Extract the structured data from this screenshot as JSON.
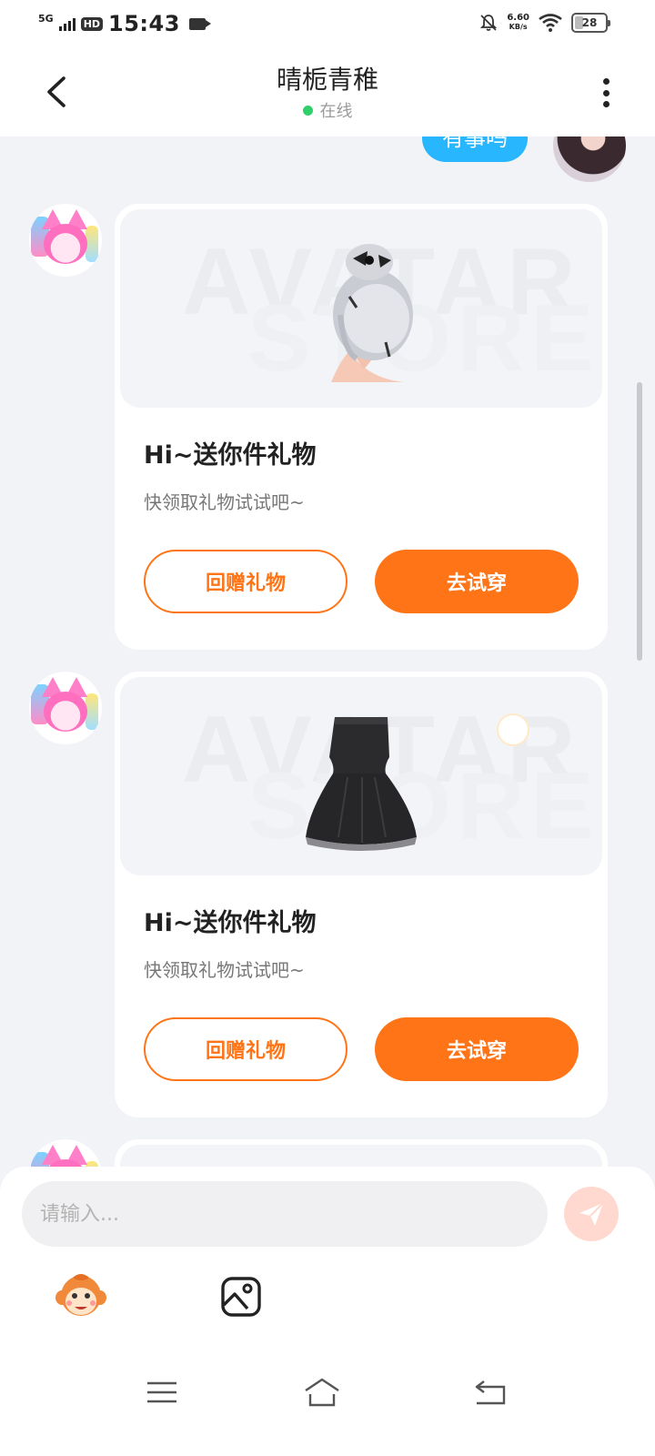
{
  "status_bar": {
    "network": "5G",
    "hd": "HD",
    "time": "15:43",
    "speed_value": "6.60",
    "speed_unit": "KB/s",
    "battery": "28"
  },
  "header": {
    "title": "晴栀青稚",
    "status": "在线"
  },
  "chat": {
    "self_bubble_text": "有事吗",
    "gifts": [
      {
        "item": "hairstyle",
        "watermark_top": "AVATAR",
        "watermark_bottom": "STORE",
        "title": "Hi~送你件礼物",
        "subtitle": "快领取礼物试试吧~",
        "return_label": "回赠礼物",
        "try_label": "去试穿"
      },
      {
        "item": "black-dress",
        "watermark_top": "AVATAR",
        "watermark_bottom": "STORE",
        "title": "Hi~送你件礼物",
        "subtitle": "快领取礼物试试吧~",
        "return_label": "回赠礼物",
        "try_label": "去试穿"
      }
    ]
  },
  "composer": {
    "placeholder": "请输入..."
  },
  "colors": {
    "accent": "#ff7417",
    "bubble": "#28b6ff",
    "online": "#2fcf6a",
    "background": "#f2f3f7"
  },
  "icons": [
    "back-icon",
    "more-icon",
    "send-icon",
    "monkey-emoji-icon",
    "image-icon",
    "menu-icon",
    "home-icon",
    "return-icon"
  ]
}
